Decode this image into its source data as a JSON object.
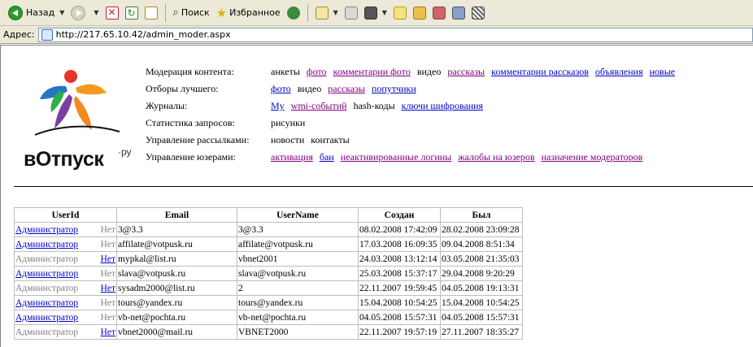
{
  "toolbar": {
    "back_label": "Назад",
    "search_label": "Поиск",
    "favorites_label": "Избранное"
  },
  "address": {
    "label": "Адрес:",
    "url": "http://217.65.10.42/admin_moder.aspx"
  },
  "logo": {
    "word": "вОтпуск",
    "suffix": "·ру"
  },
  "menu": [
    {
      "label": "Модерация контента:",
      "items": [
        {
          "text": "анкеты",
          "style": "plain"
        },
        {
          "text": "фото",
          "style": "visited"
        },
        {
          "text": "комментарии фото",
          "style": "visited"
        },
        {
          "text": "видео",
          "style": "plain"
        },
        {
          "text": "рассказы",
          "style": "visited"
        },
        {
          "text": "комментарии рассказов",
          "style": "link"
        },
        {
          "text": "объявления",
          "style": "link"
        },
        {
          "text": "новые",
          "style": "link"
        }
      ]
    },
    {
      "label": "Отборы лучшего:",
      "items": [
        {
          "text": "фото",
          "style": "link"
        },
        {
          "text": "видео",
          "style": "plain"
        },
        {
          "text": "рассказы",
          "style": "visited"
        },
        {
          "text": "попутчики",
          "style": "link"
        }
      ]
    },
    {
      "label": "Журналы:",
      "items": [
        {
          "text": "Mу",
          "style": "link"
        },
        {
          "text": "wmi-событий",
          "style": "visited"
        },
        {
          "text": "hash-коды",
          "style": "plain"
        },
        {
          "text": "ключи шифрования",
          "style": "link"
        }
      ]
    },
    {
      "label": "Статистика запросов:",
      "items": [
        {
          "text": "рисунки",
          "style": "plain"
        }
      ]
    },
    {
      "label": "Управление рассылками:",
      "items": [
        {
          "text": "новости",
          "style": "plain"
        },
        {
          "text": "контакты",
          "style": "plain"
        }
      ]
    },
    {
      "label": "Управление юзерами:",
      "items": [
        {
          "text": "активация",
          "style": "visited"
        },
        {
          "text": "бан",
          "style": "link"
        },
        {
          "text": "неактивированные логины",
          "style": "visited"
        },
        {
          "text": "жалобы на юзеров",
          "style": "visited"
        },
        {
          "text": "назначение модераторов",
          "style": "visited"
        }
      ]
    }
  ],
  "table": {
    "headers": [
      "UserId",
      "Email",
      "UserName",
      "Создан",
      "Был"
    ],
    "rows": [
      {
        "role": "Администратор",
        "role_link": true,
        "net": "Нет",
        "net_link": false,
        "email": "3@3.3",
        "username": "3@3.3",
        "created": "08.02.2008 17:42:09",
        "seen": "28.02.2008 23:09:28"
      },
      {
        "role": "Администратор",
        "role_link": true,
        "net": "Нет",
        "net_link": false,
        "email": "affilate@votpusk.ru",
        "username": "affilate@votpusk.ru",
        "created": "17.03.2008 16:09:35",
        "seen": "09.04.2008 8:51:34"
      },
      {
        "role": "Администратор",
        "role_link": false,
        "net": "Нет",
        "net_link": true,
        "email": "mypkal@list.ru",
        "username": "vbnet2001",
        "created": "24.03.2008 13:12:14",
        "seen": "03.05.2008 21:35:03"
      },
      {
        "role": "Администратор",
        "role_link": true,
        "net": "Нет",
        "net_link": false,
        "email": "slava@votpusk.ru",
        "username": "slava@votpusk.ru",
        "created": "25.03.2008 15:37:17",
        "seen": "29.04.2008 9:20:29"
      },
      {
        "role": "Администратор",
        "role_link": false,
        "net": "Нет",
        "net_link": true,
        "email": "sysadm2000@list.ru",
        "username": "2",
        "created": "22.11.2007 19:59:45",
        "seen": "04.05.2008 19:13:31"
      },
      {
        "role": "Администратор",
        "role_link": true,
        "net": "Нет",
        "net_link": false,
        "email": "tours@yandex.ru",
        "username": "tours@yandex.ru",
        "created": "15.04.2008 10:54:25",
        "seen": "15.04.2008 10:54:25"
      },
      {
        "role": "Администратор",
        "role_link": true,
        "net": "Нет",
        "net_link": false,
        "email": "vb-net@pochta.ru",
        "username": "vb-net@pochta.ru",
        "created": "04.05.2008 15:57:31",
        "seen": "04.05.2008 15:57:31"
      },
      {
        "role": "Администратор",
        "role_link": false,
        "net": "Нет",
        "net_link": true,
        "email": "vbnet2000@mail.ru",
        "username": "VBNET2000",
        "created": "22.11.2007 19:57:19",
        "seen": "27.11.2007 18:35:27"
      }
    ]
  }
}
